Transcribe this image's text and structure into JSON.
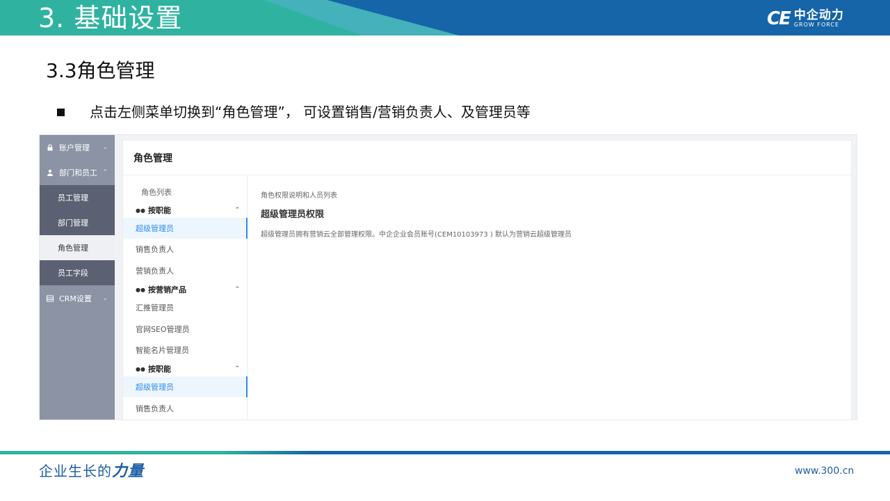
{
  "header": {
    "title": "3. 基础设置",
    "logo_mark": "CE",
    "logo_cn": "中企动力",
    "logo_en": "GROW FORCE"
  },
  "slide": {
    "section_title": "3.3角色管理",
    "bullet": "点击左侧菜单切换到“角色管理”， 可设置销售/营销负责人、及管理员等"
  },
  "sidebar": {
    "items": [
      {
        "label": "账户管理",
        "icon": "lock-icon",
        "chevron": "down"
      },
      {
        "label": "部门和员工",
        "icon": "user-icon",
        "chevron": "up"
      },
      {
        "label": "CRM设置",
        "icon": "table-icon",
        "chevron": "down"
      }
    ],
    "sub_items": [
      {
        "label": "员工管理"
      },
      {
        "label": "部门管理"
      },
      {
        "label": "角色管理",
        "active": true
      },
      {
        "label": "员工字段"
      }
    ]
  },
  "card": {
    "title": "角色管理",
    "role_list_title": "角色列表",
    "groups": [
      {
        "label": "按职能",
        "roles": [
          "超级管理员",
          "销售负责人",
          "营销负责人"
        ]
      },
      {
        "label": "按营销产品",
        "roles": [
          "汇推管理员",
          "官网SEO管理员",
          "智能名片管理员"
        ]
      },
      {
        "label": "按职能",
        "roles": [
          "超级管理员",
          "销售负责人"
        ]
      }
    ],
    "selected_role": "超级管理员",
    "detail": {
      "caption": "角色权限说明和人员列表",
      "heading": "超级管理员权限",
      "description": "超级管理员拥有营销云全部管理权限。中企企业会员账号(CEM10103973 ) 默认为营销云超级管理员"
    }
  },
  "footer": {
    "slogan_regular": "企业生长的",
    "slogan_bold": "力量",
    "site": "www.300.cn"
  },
  "colors": {
    "header_blue": "#1565a8",
    "header_teal": "#2fb3a0",
    "sidebar": "#8b93a5",
    "sidebar_sub": "#5b6172",
    "accent": "#2d8cf0"
  }
}
